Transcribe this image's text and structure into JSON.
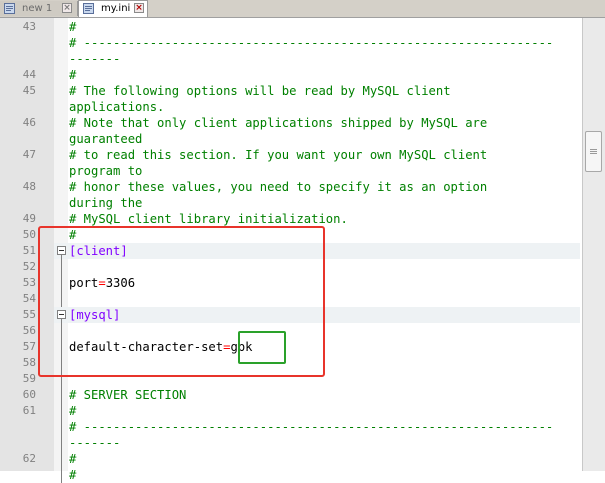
{
  "tabs": [
    {
      "label": "new 1",
      "active": false
    },
    {
      "label": "my.ini",
      "active": true
    }
  ],
  "editor": {
    "rows": [
      {
        "ln": "43",
        "text": "#",
        "cls": ""
      },
      {
        "ln": "",
        "text": "# ----------------------------------------------------------------",
        "cls": ""
      },
      {
        "ln": "",
        "text": "-------",
        "cls": ""
      },
      {
        "ln": "44",
        "text": "#",
        "cls": ""
      },
      {
        "ln": "45",
        "text": "# The following options will be read by MySQL client",
        "cls": ""
      },
      {
        "ln": "",
        "text": "applications.",
        "cls": ""
      },
      {
        "ln": "46",
        "text": "# Note that only client applications shipped by MySQL are",
        "cls": ""
      },
      {
        "ln": "",
        "text": "guaranteed",
        "cls": ""
      },
      {
        "ln": "47",
        "text": "# to read this section. If you want your own MySQL client",
        "cls": ""
      },
      {
        "ln": "",
        "text": "program to",
        "cls": ""
      },
      {
        "ln": "48",
        "text": "# honor these values, you need to specify it as an option",
        "cls": ""
      },
      {
        "ln": "",
        "text": "during the",
        "cls": ""
      },
      {
        "ln": "49",
        "text": "# MySQL client library initialization.",
        "cls": ""
      },
      {
        "ln": "50",
        "text": "#",
        "cls": ""
      },
      {
        "ln": "51",
        "text": "[client]",
        "cls": "section"
      },
      {
        "ln": "52",
        "text": "",
        "cls": ""
      },
      {
        "ln": "53",
        "key": "port",
        "eq": "=",
        "val": "3306",
        "cls": "kv"
      },
      {
        "ln": "54",
        "text": "",
        "cls": ""
      },
      {
        "ln": "55",
        "text": "[mysql]",
        "cls": "section"
      },
      {
        "ln": "56",
        "text": "",
        "cls": ""
      },
      {
        "ln": "57",
        "key": "default-character-set",
        "eq": "=",
        "val": "gbk",
        "cls": "kv"
      },
      {
        "ln": "58",
        "text": "",
        "cls": ""
      },
      {
        "ln": "59",
        "text": "",
        "cls": ""
      },
      {
        "ln": "60",
        "text": "# SERVER SECTION",
        "cls": ""
      },
      {
        "ln": "61",
        "text": "#",
        "cls": ""
      },
      {
        "ln": "",
        "text": "# ----------------------------------------------------------------",
        "cls": ""
      },
      {
        "ln": "",
        "text": "-------",
        "cls": ""
      },
      {
        "ln": "62",
        "text": "#",
        "cls": ""
      },
      {
        "ln": "",
        "text": "#",
        "cls": ""
      }
    ]
  },
  "colors": {
    "comment": "#008000",
    "section": "#8000ff",
    "operator": "#ff0000",
    "highlight_red": "#e8342b",
    "highlight_green": "#2aa12a"
  },
  "icons": [
    "notepad-file-icon",
    "close-tab-icon",
    "fold-minus-icon"
  ]
}
